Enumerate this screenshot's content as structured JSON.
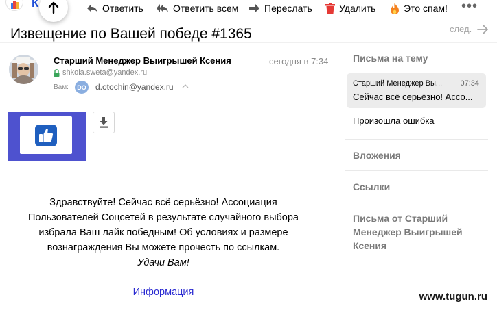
{
  "logo": {
    "text": "К С"
  },
  "toolbar": {
    "reply": "Ответить",
    "reply_all": "Ответить всем",
    "forward": "Переслать",
    "delete": "Удалить",
    "spam": "Это спам!",
    "more": "•••"
  },
  "subject": "Извещение по Вашей победе #1365",
  "next_label": "след.",
  "sender": {
    "name": "Старший Менеджер Выигрышей Ксения",
    "time": "сегодня в 7:34",
    "email": "shkola.sweta@yandex.ru",
    "to_label": "Вам:",
    "to_initials": "DO",
    "to_email": "d.otochin@yandex.ru"
  },
  "body": {
    "lines": [
      "Здравствуйте! Сейчас всё серьёзно! Ассоциация",
      "Пользователей Соцсетей в результате случайного выбора",
      "избрала Ваш лайк победным! Об условиях и размере",
      "вознаграждения Вы можете прочесть по ссылкам."
    ],
    "closing": "Удачи Вам!",
    "link_text": "Информация",
    "link_href": "#"
  },
  "sidebar": {
    "thread_header": "Письма на тему",
    "active": {
      "sender": "Старший Менеджер Вы...",
      "time": "07:34",
      "subject": "Сейчас всё серьёзно! Ассо..."
    },
    "error_item": "Произошла ошибка",
    "attachments": "Вложения",
    "links": "Ссылки",
    "from_sender": [
      "Письма от Старший",
      "Менеджер Выигрышей",
      "Ксения"
    ]
  },
  "watermark": "www.tugun.ru",
  "colors": {
    "lock": "#3aa55a",
    "badge": "#8aaee0",
    "attachment_card": "#4e52cf",
    "sidebar_active_bg": "#ececec",
    "delete_icon": "#e53935",
    "spam_icon": "#f5821f",
    "link": "#2a2ad1"
  }
}
